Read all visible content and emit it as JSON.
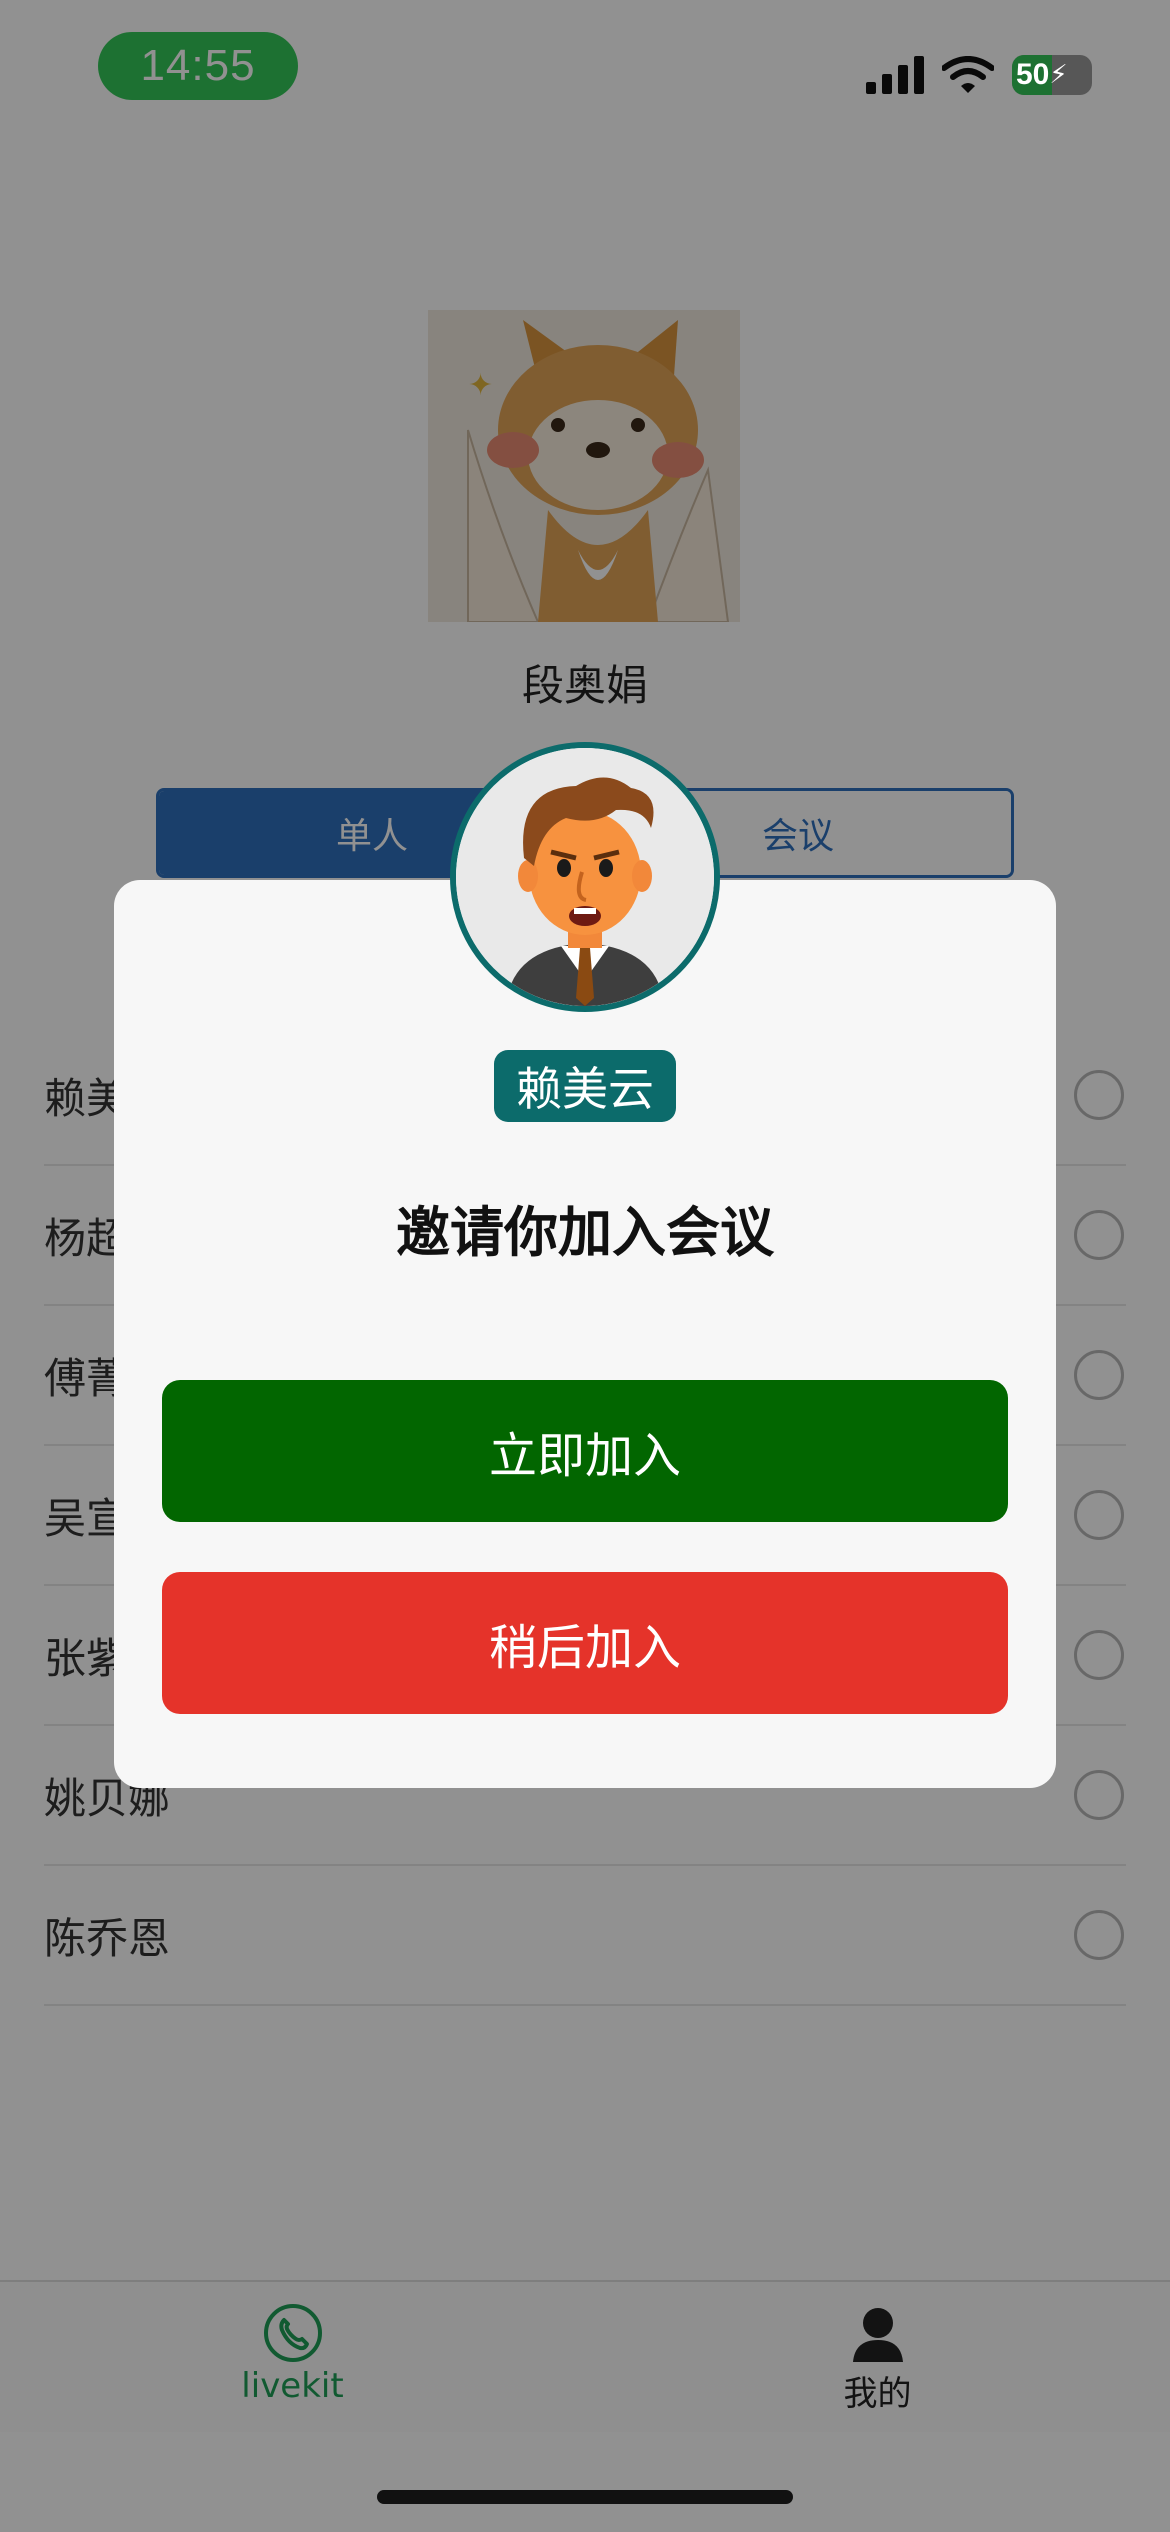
{
  "status_bar": {
    "time": "14:55",
    "battery_level": "50",
    "battery_fraction": 0.5
  },
  "profile": {
    "name": "段奥娟"
  },
  "segment": {
    "single_label": "单人",
    "meeting_label": "会议"
  },
  "contacts": [
    {
      "name": "赖美云"
    },
    {
      "name": "杨超越"
    },
    {
      "name": "傅菁"
    },
    {
      "name": "吴宣仪"
    },
    {
      "name": "张紫宁"
    },
    {
      "name": "姚贝娜"
    },
    {
      "name": "陈乔恩"
    }
  ],
  "tabbar": {
    "livekit_label": "livekit",
    "mine_label": "我的"
  },
  "dialog": {
    "caller_name": "赖美云",
    "invite_text": "邀请你加入会议",
    "join_now_label": "立即加入",
    "join_later_label": "稍后加入"
  },
  "colors": {
    "accent_teal": "#0c6b6b",
    "join_green": "#026600",
    "later_red": "#e5332a",
    "tab_active": "#1e9e57",
    "segment_blue": "#2f6fbd"
  }
}
